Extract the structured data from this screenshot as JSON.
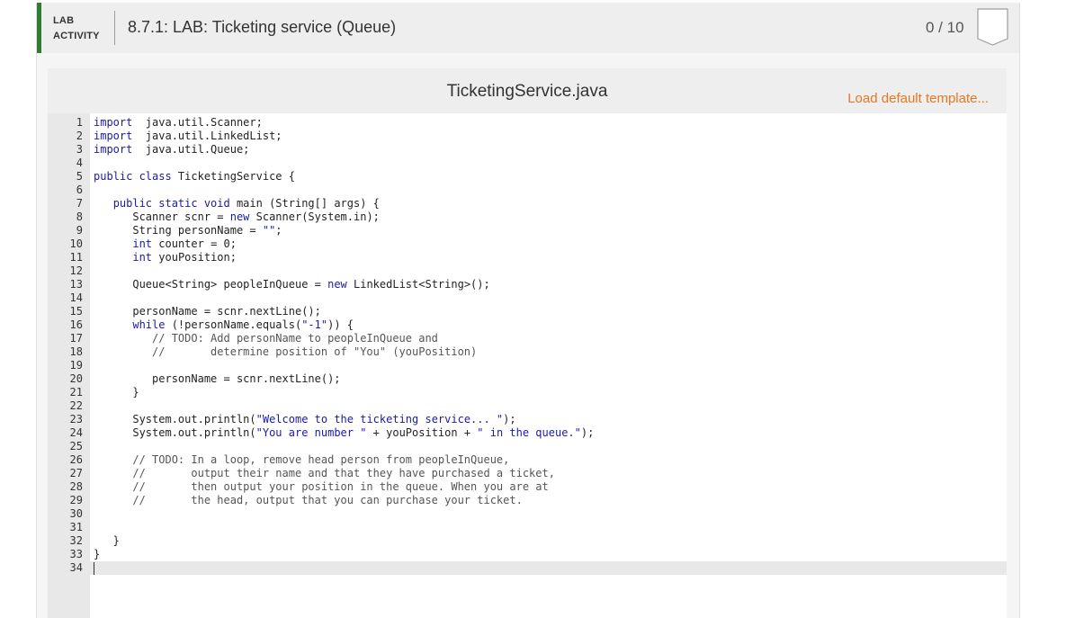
{
  "header": {
    "tag_line1": "LAB",
    "tag_line2": "ACTIVITY",
    "title": "8.7.1: LAB: Ticketing service (Queue)",
    "score": "0 / 10",
    "accent_color": "#2e7d32"
  },
  "editor": {
    "file_name": "TicketingService.java",
    "load_template_label": "Load default template...",
    "accent_color": "#e87722",
    "active_line": 34,
    "lines": [
      [
        [
          "kw",
          "import"
        ],
        [
          "",
          "  java.util.Scanner;"
        ]
      ],
      [
        [
          "kw",
          "import"
        ],
        [
          "",
          "  java.util.LinkedList;"
        ]
      ],
      [
        [
          "kw",
          "import"
        ],
        [
          "",
          "  java.util.Queue;"
        ]
      ],
      [],
      [
        [
          "kw",
          "public class"
        ],
        [
          "",
          " TicketingService {"
        ]
      ],
      [],
      [
        [
          "",
          "   "
        ],
        [
          "kw",
          "public static void"
        ],
        [
          "",
          " main (String[] args) {"
        ]
      ],
      [
        [
          "",
          "      Scanner scnr = "
        ],
        [
          "kw",
          "new"
        ],
        [
          "",
          " Scanner(System.in);"
        ]
      ],
      [
        [
          "",
          "      String personName = "
        ],
        [
          "str",
          "\"\""
        ],
        [
          "",
          ";"
        ]
      ],
      [
        [
          "",
          "      "
        ],
        [
          "kw",
          "int"
        ],
        [
          "",
          " counter = 0;"
        ]
      ],
      [
        [
          "",
          "      "
        ],
        [
          "kw",
          "int"
        ],
        [
          "",
          " youPosition;"
        ]
      ],
      [],
      [
        [
          "",
          "      Queue<String> peopleInQueue = "
        ],
        [
          "kw",
          "new"
        ],
        [
          "",
          " LinkedList<String>();"
        ]
      ],
      [],
      [
        [
          "",
          "      personName = scnr.nextLine();"
        ]
      ],
      [
        [
          "",
          "      "
        ],
        [
          "kw",
          "while"
        ],
        [
          "",
          " (!personName.equals("
        ],
        [
          "str",
          "\"-1\""
        ],
        [
          "",
          ")) {"
        ]
      ],
      [
        [
          "cm",
          "         // TODO: Add personName to peopleInQueue and"
        ]
      ],
      [
        [
          "cm",
          "         //       determine position of \"You\" (youPosition)"
        ]
      ],
      [],
      [
        [
          "",
          "         personName = scnr.nextLine();"
        ]
      ],
      [
        [
          "",
          "      }"
        ]
      ],
      [],
      [
        [
          "",
          "      System.out.println("
        ],
        [
          "str",
          "\"Welcome to the ticketing service... \""
        ],
        [
          "",
          ");"
        ]
      ],
      [
        [
          "",
          "      System.out.println("
        ],
        [
          "str",
          "\"You are number \""
        ],
        [
          "",
          " + youPosition + "
        ],
        [
          "str",
          "\" in the queue.\""
        ],
        [
          "",
          ");"
        ]
      ],
      [],
      [
        [
          "cm",
          "      // TODO: In a loop, remove head person from peopleInQueue,"
        ]
      ],
      [
        [
          "cm",
          "      //       output their name and that they have purchased a ticket,"
        ]
      ],
      [
        [
          "cm",
          "      //       then output your position in the queue. When you are at"
        ]
      ],
      [
        [
          "cm",
          "      //       the head, output that you can purchase your ticket."
        ]
      ],
      [],
      [],
      [
        [
          "",
          "   }"
        ]
      ],
      [
        [
          "",
          "}"
        ]
      ],
      []
    ]
  }
}
